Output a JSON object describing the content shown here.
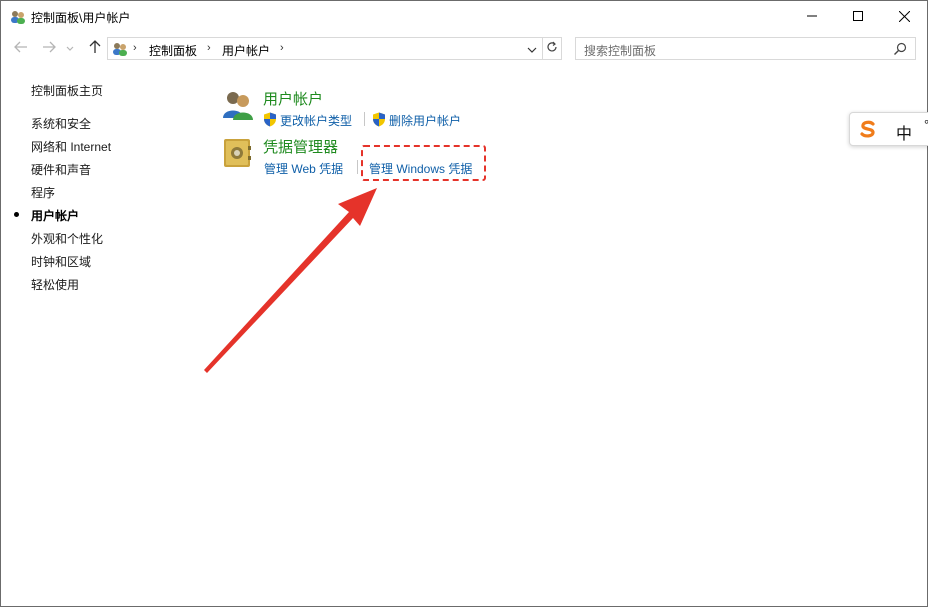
{
  "window": {
    "title": "控制面板\\用户帐户",
    "icon": "user-accounts-icon",
    "controls": [
      "minimize-icon",
      "maximize-icon",
      "close-icon"
    ]
  },
  "nav": {
    "back": "back-arrow-icon",
    "forward": "forward-arrow-icon",
    "recent": "chevron-down-icon",
    "up": "up-arrow-icon"
  },
  "address": {
    "crumbs": [
      "控制面板",
      "用户帐户"
    ],
    "separator": "›"
  },
  "search": {
    "placeholder": "搜索控制面板"
  },
  "sidebar": {
    "home": "控制面板主页",
    "items": [
      {
        "label": "系统和安全"
      },
      {
        "label": "网络和 Internet"
      },
      {
        "label": "硬件和声音"
      },
      {
        "label": "程序"
      },
      {
        "label": "用户帐户",
        "current": true
      },
      {
        "label": "外观和个性化"
      },
      {
        "label": "时钟和区域"
      },
      {
        "label": "轻松使用"
      }
    ]
  },
  "main": {
    "categories": [
      {
        "title": "用户帐户",
        "icon": "user-accounts-icon",
        "links": [
          {
            "label": "更改帐户类型",
            "shield": true
          },
          {
            "label": "删除用户帐户",
            "shield": true
          }
        ]
      },
      {
        "title": "凭据管理器",
        "icon": "credential-vault-icon",
        "links": [
          {
            "label": "管理 Web 凭据",
            "shield": false
          },
          {
            "label": "管理 Windows 凭据",
            "shield": false
          }
        ]
      }
    ]
  },
  "ime": {
    "logo": "sogou-s-icon",
    "mode": "中",
    "extra": "°"
  },
  "colors": {
    "category_title": "#1e8a1e",
    "link": "#0f5fa8",
    "annotation": "#e5332a"
  }
}
